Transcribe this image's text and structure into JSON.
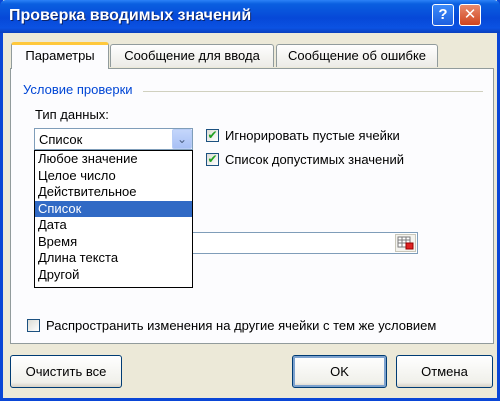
{
  "window": {
    "title": "Проверка вводимых значений",
    "help_glyph": "?",
    "close_glyph": "✕"
  },
  "tabs": [
    {
      "label": "Параметры",
      "active": true
    },
    {
      "label": "Сообщение для ввода",
      "active": false
    },
    {
      "label": "Сообщение об ошибке",
      "active": false
    }
  ],
  "group": {
    "title": "Условие проверки",
    "type_label": "Тип данных:",
    "selected_type": "Список",
    "dropdown_options": [
      "Любое значение",
      "Целое число",
      "Действительное",
      "Список",
      "Дата",
      "Время",
      "Длина текста",
      "Другой"
    ],
    "selected_index": 3
  },
  "checkboxes": {
    "ignore_blank": {
      "label": "Игнорировать пустые ячейки",
      "checked": true
    },
    "in_cell_dropdown": {
      "label": "Список допустимых значений",
      "checked": true
    },
    "apply_all": {
      "label": "Распространить изменения на другие ячейки с тем же условием",
      "checked": false
    }
  },
  "check_glyph": "✔",
  "combo_arrow_glyph": "⌄",
  "buttons": {
    "clear_all": "Очистить все",
    "ok": "OK",
    "cancel": "Отмена"
  },
  "colors": {
    "title_bar": "#0648d8",
    "selection": "#316ac5",
    "group_title": "#0046d5",
    "tab_highlight": "#ffc83c"
  }
}
